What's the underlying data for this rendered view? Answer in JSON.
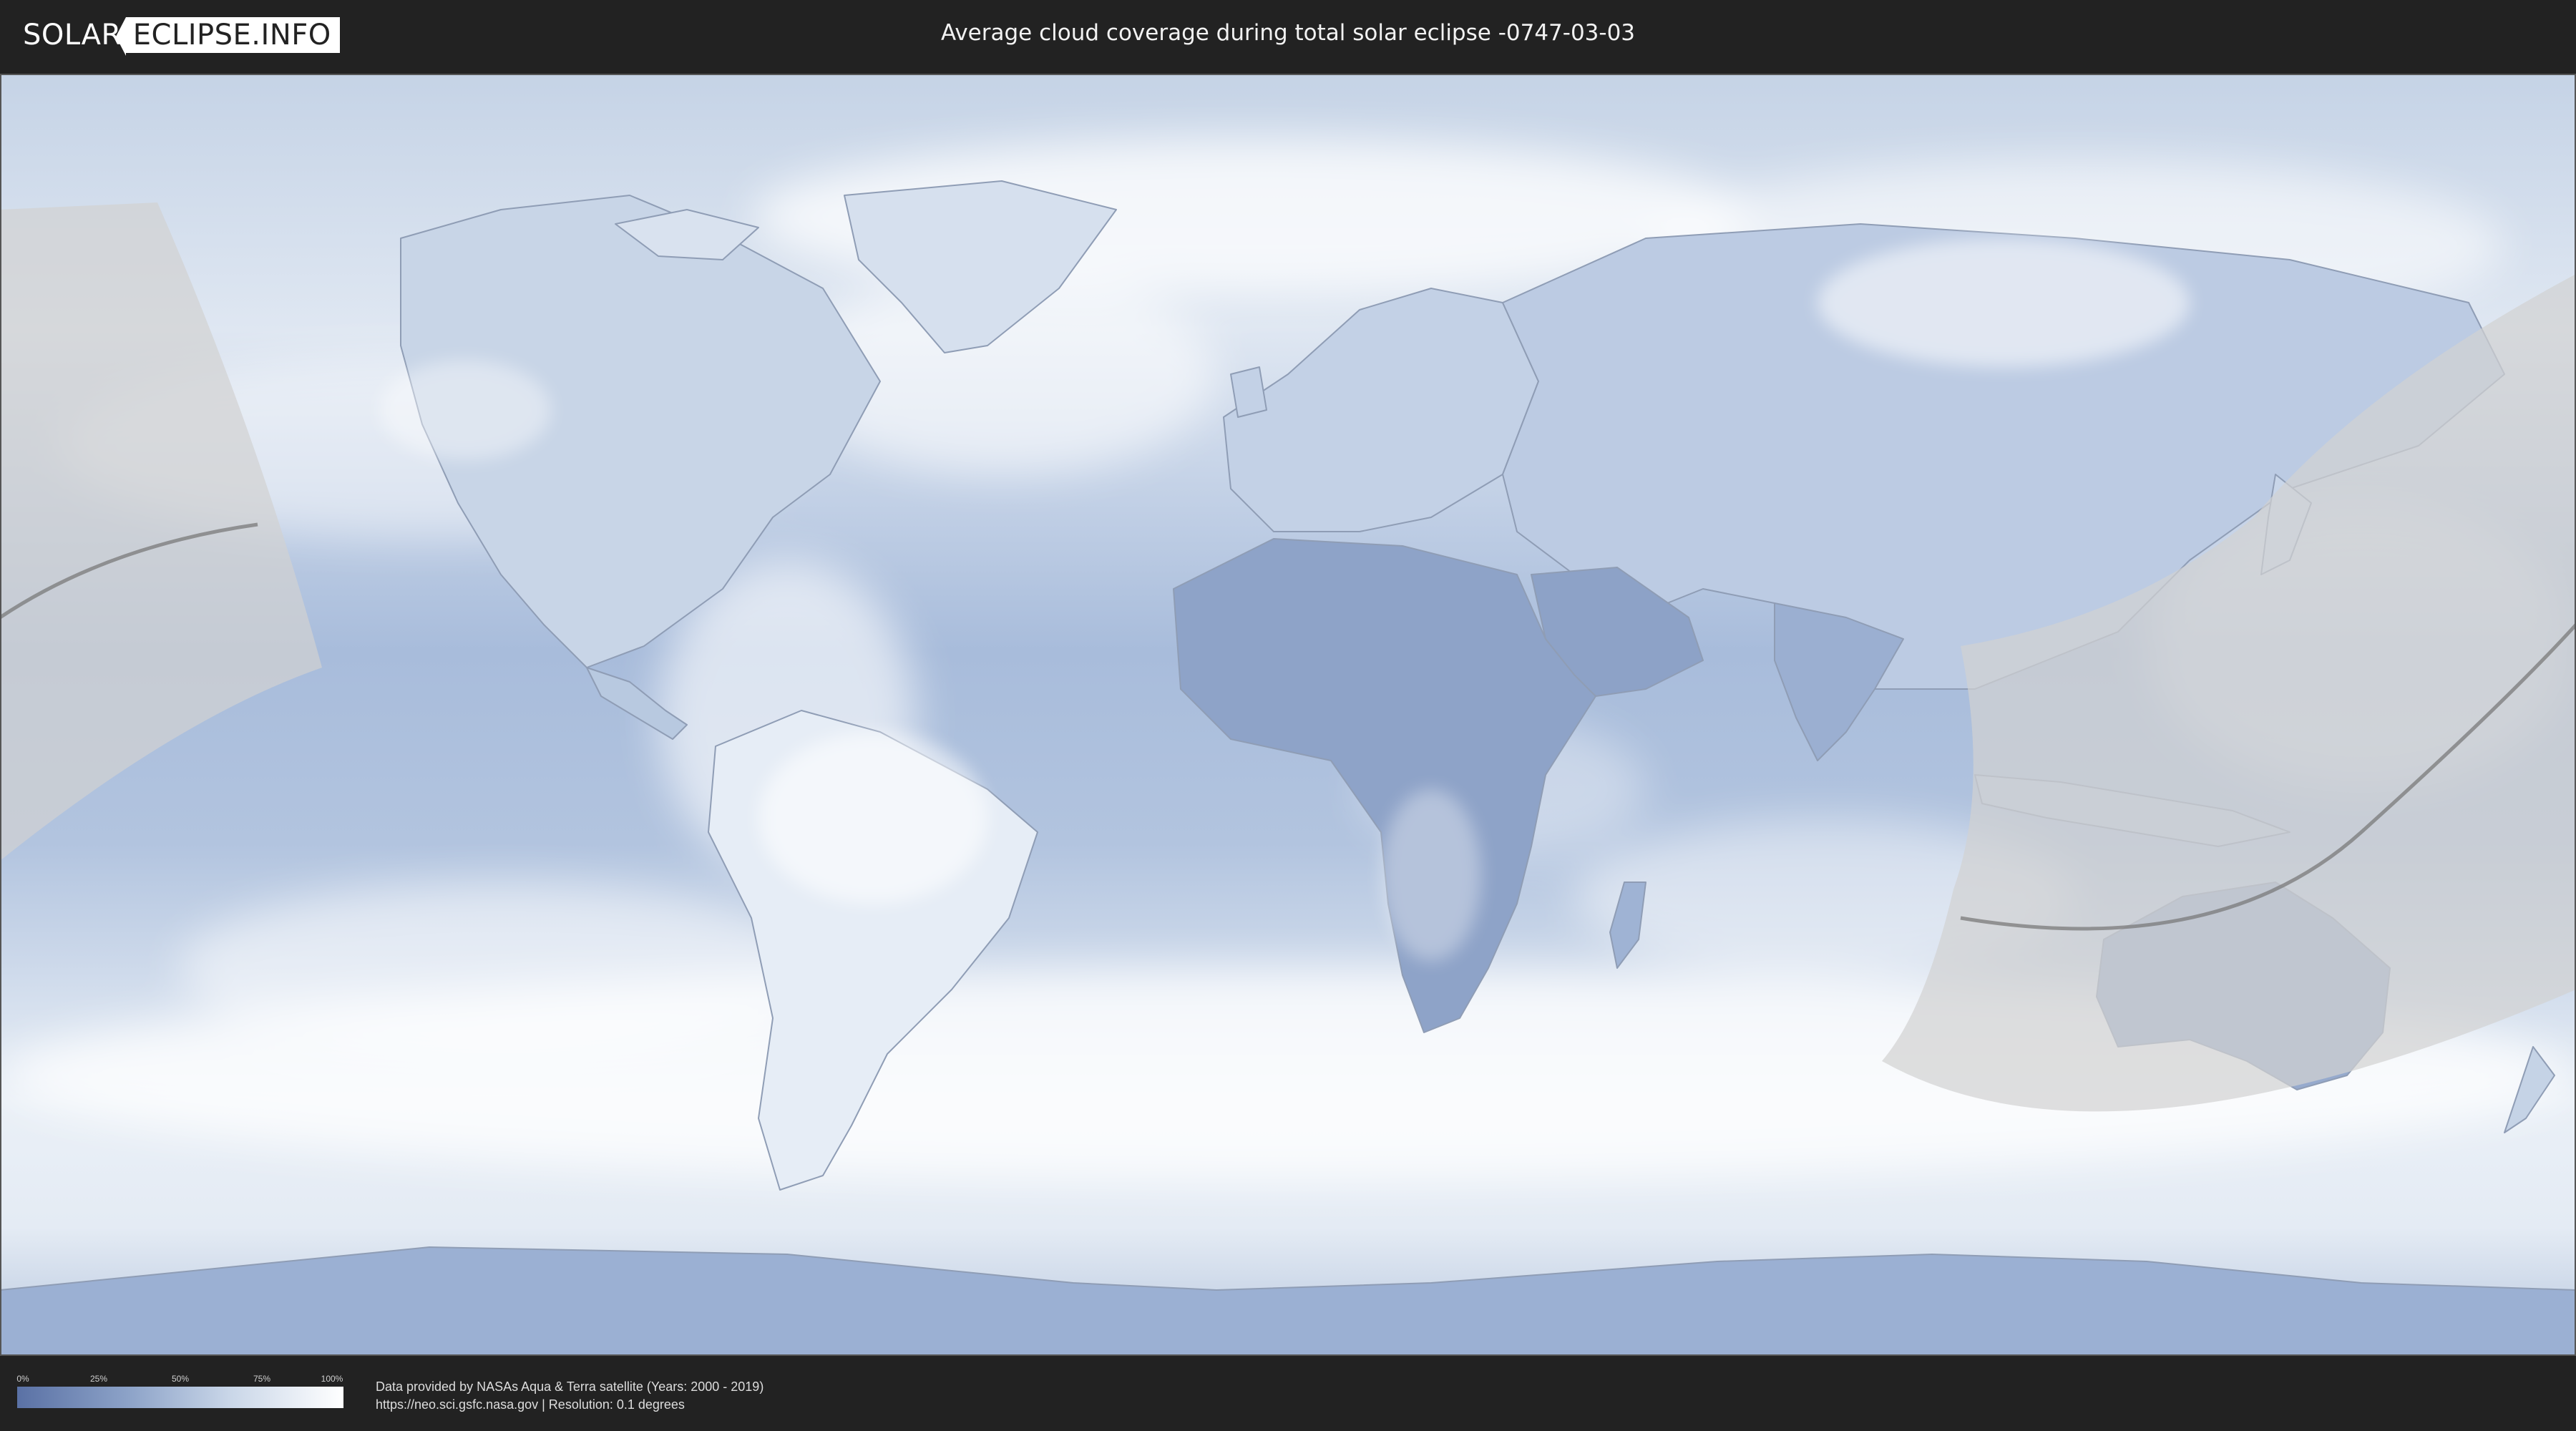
{
  "header": {
    "logo_left": "SOLAR",
    "logo_right": "ECLIPSE.INFO",
    "title": "Average cloud coverage during total solar eclipse -0747-03-03"
  },
  "map": {
    "kind": "equirectangular world cloud-coverage map",
    "ocean_color": "#9fb5d6",
    "land_stroke": "#8796b0",
    "cloud_color": "#ffffff",
    "eclipse_zone_color": "#d2d2d2",
    "path_color": "#7a7a7a"
  },
  "legend": {
    "ticks": [
      "0%",
      "25%",
      "50%",
      "75%",
      "100%"
    ],
    "gradient_start": "#5a71a5",
    "gradient_end": "#ffffff"
  },
  "credits": {
    "line1": "Data provided by NASAs Aqua & Terra satellite (Years: 2000 - 2019)",
    "line2": "https://neo.sci.gsfc.nasa.gov | Resolution: 0.1 degrees"
  }
}
